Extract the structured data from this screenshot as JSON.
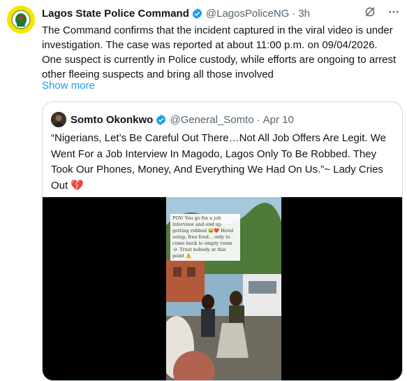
{
  "tweet": {
    "author_name": "Lagos State Police Command",
    "handle": "@LagosPoliceNG",
    "separator": "·",
    "time": "3h",
    "text": "The Command confirms that the incident captured in the viral video is under investigation. The case was reported at about 11:00 p.m. on 09/04/2026. One suspect is currently in Police custody, while efforts are ongoing to arrest other fleeing suspects and bring all those involved",
    "show_more": "Show more"
  },
  "quoted": {
    "author_name": "Somto Okonkwo",
    "handle": "@General_Somto",
    "separator": "·",
    "date": "Apr 10",
    "text": "“Nigerians, Let’s Be Careful Out There…Not All Job Offers Are Legit. We Went For a Job Interview In Magodo, Lagos Only To Be Robbed. They Took Our Phones, Money, And Everything We Had On Us.”~ Lady Cries Out 💔",
    "video_caption": "POV: You go for a job interview and end up getting robbed 😂❤️ Hotel setup, free food... only to come back to empty room 💀 Trust nobody at this point ⚠️"
  },
  "colors": {
    "accent": "#1d9bf0",
    "muted": "#536471",
    "border": "#cfd9de",
    "avatar_bg": "#f7e400"
  },
  "icons": [
    "verified-badge-icon",
    "grok-icon",
    "more-icon",
    "verified-badge-icon"
  ]
}
